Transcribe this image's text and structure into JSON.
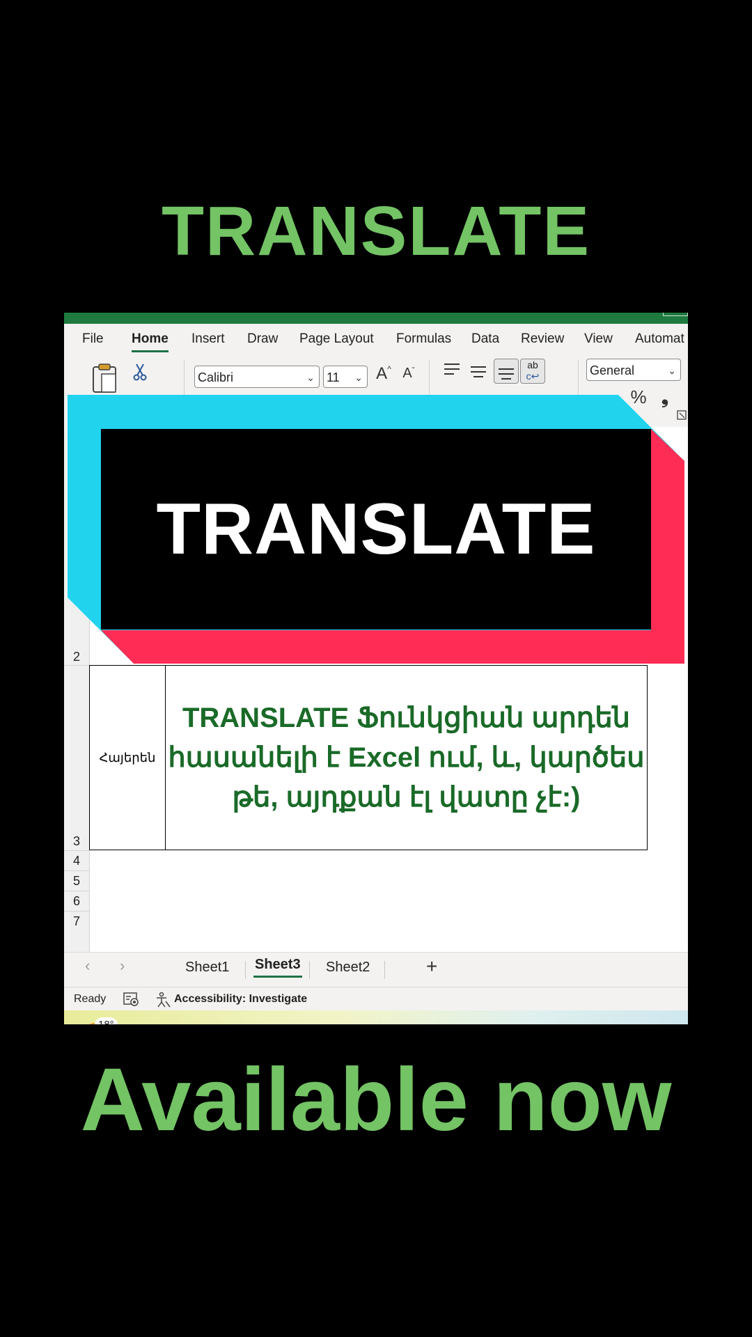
{
  "overlay": {
    "top_title": "TRANSLATE",
    "banner_title": "TRANSLATE",
    "bottom_title": "Available now"
  },
  "menu": [
    "File",
    "Home",
    "Insert",
    "Draw",
    "Page Layout",
    "Formulas",
    "Data",
    "Review",
    "View",
    "Automat"
  ],
  "ribbon": {
    "font_name": "Calibri",
    "font_size": "11",
    "number_format": "General",
    "grow_font": "A",
    "shrink_font": "A",
    "percent": "%",
    "comma": "❟",
    "wrap_text_glyph": "ab"
  },
  "grid": {
    "rows": [
      "2",
      "3",
      "4",
      "5",
      "6",
      "7"
    ],
    "cell_label": "Հայերեն",
    "cell_text": "TRANSLATE Ֆունկցիան արդեն հասանելի է Excel ում, և, կարծես թե, այդքան էլ վատը չէ:)"
  },
  "sheets": {
    "tabs": [
      "Sheet1",
      "Sheet3",
      "Sheet2"
    ],
    "active": "Sheet3",
    "add": "+"
  },
  "status": {
    "ready": "Ready",
    "accessibility": "Accessibility: Investigate"
  },
  "taskbar": {
    "weather_temp": "18°"
  },
  "colors": {
    "accent_green": "#74c365",
    "excel_green": "#1e7145",
    "cell_text_green": "#1a6a28",
    "banner_cyan": "#22d3ee",
    "banner_red": "#ff2d55"
  }
}
